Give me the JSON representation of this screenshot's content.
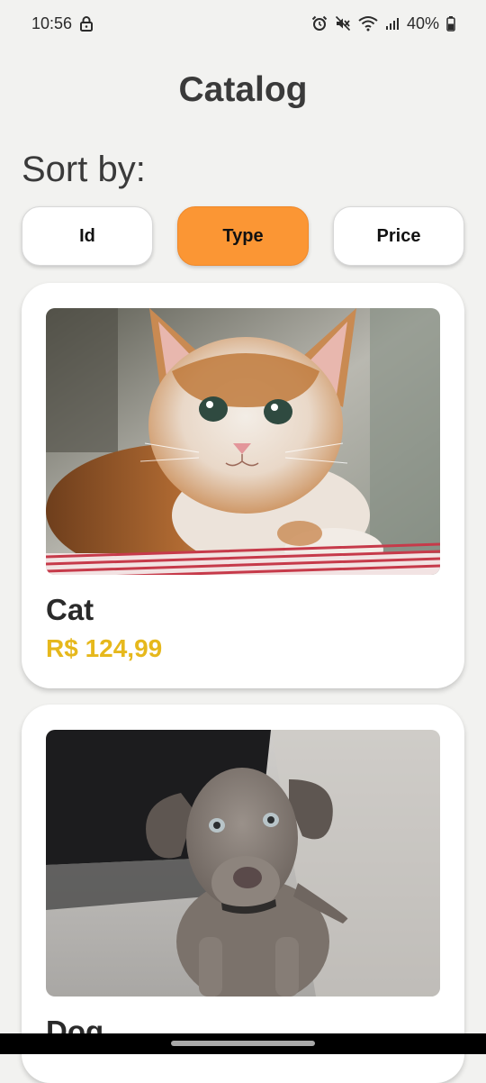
{
  "status_bar": {
    "time": "10:56",
    "battery": "40%",
    "icons": [
      "lock-icon",
      "alarm-icon",
      "mute-icon",
      "wifi-icon",
      "signal-icon",
      "battery-icon"
    ]
  },
  "header": {
    "title": "Catalog"
  },
  "sort": {
    "label": "Sort by:",
    "options": [
      {
        "label": "Id",
        "selected": false
      },
      {
        "label": "Type",
        "selected": true
      },
      {
        "label": "Price",
        "selected": false
      }
    ],
    "active_color": "#fb9634"
  },
  "products": [
    {
      "name": "Cat",
      "price": "R$ 124,99",
      "image": "kitten-photo"
    },
    {
      "name": "Dog",
      "image": "puppy-photo"
    }
  ],
  "colors": {
    "price": "#e6b81c",
    "background": "#f2f2f0",
    "card": "#ffffff"
  }
}
